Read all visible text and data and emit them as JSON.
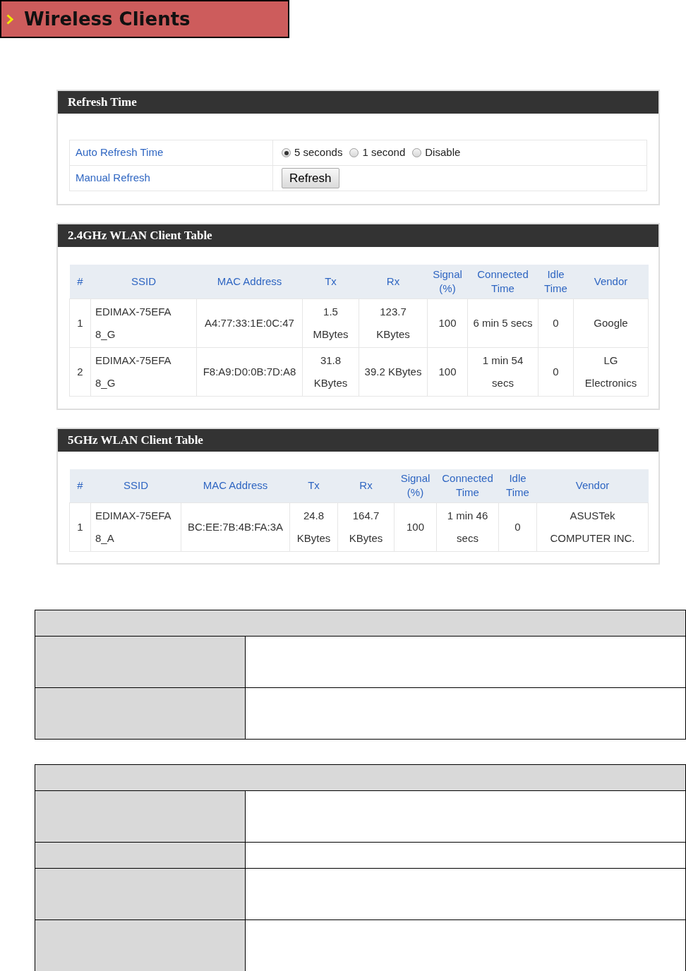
{
  "page_title": "Wireless Clients",
  "refresh_panel": {
    "title": "Refresh Time",
    "rows": [
      {
        "kind": "radio_group",
        "label": "Auto Refresh Time",
        "options": [
          {
            "label": "5 seconds",
            "selected": true
          },
          {
            "label": "1 second",
            "selected": false
          },
          {
            "label": "Disable",
            "selected": false
          }
        ]
      },
      {
        "kind": "button",
        "label": "Manual Refresh",
        "button": "Refresh"
      }
    ]
  },
  "client_tables": [
    {
      "title": "2.4GHz WLAN Client Table",
      "columns": [
        "#",
        "SSID",
        "MAC Address",
        "Tx",
        "Rx",
        "Signal (%)",
        "Connected Time",
        "Idle Time",
        "Vendor"
      ],
      "rows": [
        [
          "1",
          "EDIMAX-75EFA8_G",
          "A4:77:33:1E:0C:47",
          "1.5 MBytes",
          "123.7 KBytes",
          "100",
          "6 min 5 secs",
          "0",
          "Google"
        ],
        [
          "2",
          "EDIMAX-75EFA8_G",
          "F8:A9:D0:0B:7D:A8",
          "31.8 KBytes",
          "39.2 KBytes",
          "100",
          "1 min 54 secs",
          "0",
          "LG Electronics"
        ]
      ]
    },
    {
      "title": "5GHz WLAN Client Table",
      "columns": [
        "#",
        "SSID",
        "MAC Address",
        "Tx",
        "Rx",
        "Signal (%)",
        "Connected Time",
        "Idle Time",
        "Vendor"
      ],
      "rows": [
        [
          "1",
          "EDIMAX-75EFA8_A",
          "BC:EE:7B:4B:FA:3A",
          "24.8 KBytes",
          "164.7 KBytes",
          "100",
          "1 min 46 secs",
          "0",
          "ASUSTek COMPUTER INC."
        ]
      ]
    }
  ],
  "blank_tables": [
    {
      "rows": [
        {
          "kind": "tall"
        },
        {
          "kind": "tall"
        }
      ]
    },
    {
      "rows": [
        {
          "kind": "tall"
        },
        {
          "kind": "short"
        },
        {
          "kind": "tall"
        },
        {
          "kind": "tall"
        }
      ]
    }
  ]
}
